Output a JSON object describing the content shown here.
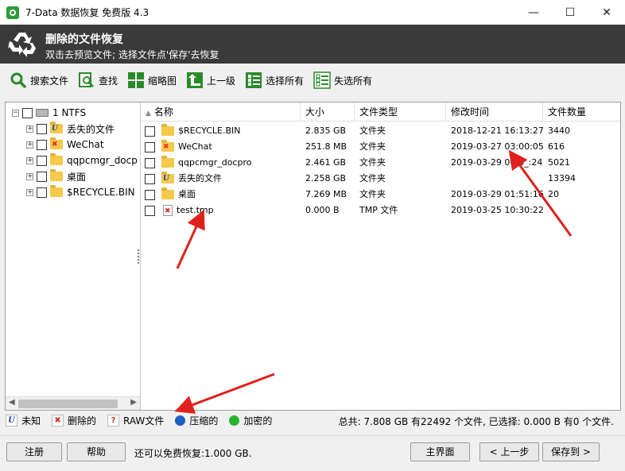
{
  "window": {
    "title": "7-Data 数据恢复 免费版 4.3",
    "controls": [
      "—",
      "☐",
      "✕"
    ]
  },
  "header": {
    "title": "删除的文件恢复",
    "subtitle": "双击去预览文件; 选择文件点'保存'去恢复"
  },
  "toolbar": {
    "search": "搜索文件",
    "find": "查找",
    "thumbnails": "缩略图",
    "up_level": "上一级",
    "select_all": "选择所有",
    "deselect_all": "失选所有"
  },
  "tree": {
    "root": "1 NTFS",
    "items": [
      "丢失的文件",
      "WeChat",
      "qqpcmgr_docp",
      "桌面",
      "$RECYCLE.BIN"
    ]
  },
  "columns": {
    "name": "名称",
    "size": "大小",
    "type": "文件类型",
    "modified": "修改时间",
    "count": "文件数量"
  },
  "rows": [
    {
      "name": "$RECYCLE.BIN",
      "size": "2.835 GB",
      "type": "文件夹",
      "modified": "2018-12-21 16:13:27",
      "count": "3440"
    },
    {
      "name": "WeChat",
      "size": "251.8 MB",
      "type": "文件夹",
      "modified": "2019-03-27 03:00:05",
      "count": "616"
    },
    {
      "name": "qqpcmgr_docpro",
      "size": "2.461 GB",
      "type": "文件夹",
      "modified": "2019-03-29 00:3_:24",
      "count": "5021"
    },
    {
      "name": "丢失的文件",
      "size": "2.258 GB",
      "type": "文件夹",
      "modified": "",
      "count": "13394"
    },
    {
      "name": "桌面",
      "size": "7.269 MB",
      "type": "文件夹",
      "modified": "2019-03-29 01:51:16",
      "count": "20"
    },
    {
      "name": "test.tmp",
      "size": "0.000 B",
      "type": "TMP 文件",
      "modified": "2019-03-25 10:30:22",
      "count": ""
    }
  ],
  "legend": {
    "unknown": "未知",
    "deleted": "删除的",
    "raw": "RAW文件",
    "compressed": "压缩的",
    "encrypted": "加密的",
    "unknown_icon": "U",
    "deleted_icon": "✖",
    "raw_icon": "?",
    "compressed_color": "#1f5fbf",
    "encrypted_color": "#28b32e"
  },
  "summary": "总共: 7.808 GB 有22492 个文件, 已选择: 0.000 B 有0 个文件.",
  "footer": {
    "register": "注册",
    "help": "帮助",
    "free_quota": "还可以免费恢复:1.000 GB.",
    "main_menu": "主界面",
    "prev": "< 上一步",
    "save_to": "保存到 >"
  }
}
